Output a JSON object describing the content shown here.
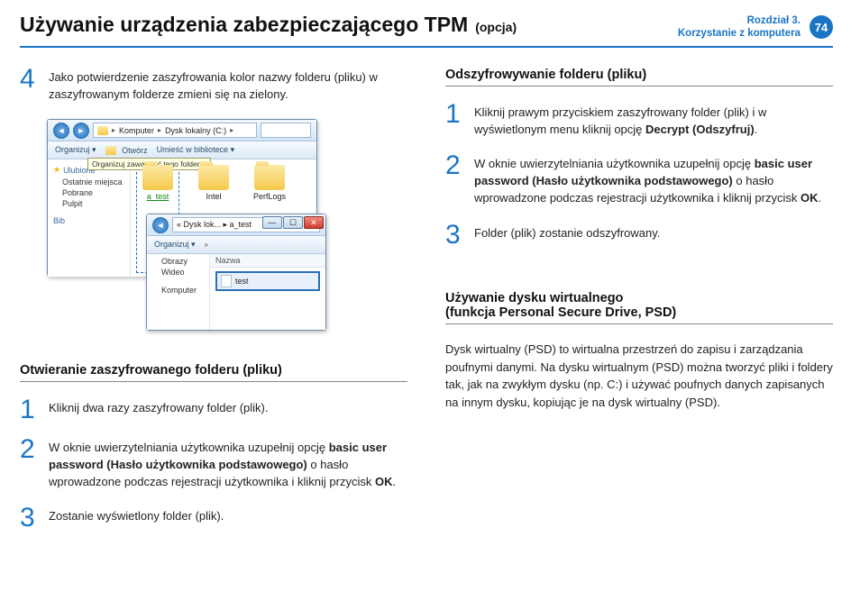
{
  "header": {
    "title": "Używanie urządzenia zabezpieczającego TPM",
    "option": "(opcja)",
    "chapter_line1": "Rozdział 3.",
    "chapter_line2": "Korzystanie z komputera",
    "page_number": "74"
  },
  "left": {
    "step4_num": "4",
    "step4_text": "Jako potwierdzenie zaszyfrowania kolor nazwy folderu (pliku) w zaszyfrowanym folderze zmieni się na zielony.",
    "screenshot": {
      "breadcrumb_parts": [
        "Komputer",
        "Dysk lokalny (C:)"
      ],
      "search_placeholder": "",
      "toolbar": {
        "organize": "Organizuj ▾",
        "open": "Otwórz",
        "library": "Umieść w bibliotece ▾",
        "tooltip": "Organizuj zawartość tego folderu."
      },
      "sidebar": {
        "favorites": "Ulubione",
        "recent": "Ostatnie miejsca",
        "downloads": "Pobrane",
        "desktop": "Pulpit",
        "libs": "Bib"
      },
      "folders": {
        "f1": "a_test",
        "f2": "Intel",
        "f3": "PerfLogs"
      },
      "win2": {
        "path": "« Dysk lok... ▸ a_test",
        "organize": "Organizuj ▾",
        "col_header": "Nazwa",
        "side_images": "Obrazy",
        "side_video": "Wideo",
        "side_computer": "Komputer",
        "file": "test"
      }
    },
    "subhead_open": "Otwieranie zaszyfrowanego folderu (pliku)",
    "open1_num": "1",
    "open1_text": "Kliknij dwa razy zaszyfrowany folder (plik).",
    "open2_num": "2",
    "open2_pre": "W oknie uwierzytelniania użytkownika uzupełnij opcję ",
    "open2_bold": "basic user password (Hasło użytkownika podstawowego)",
    "open2_mid": " o hasło wprowadzone podczas rejestracji użytkownika i kliknij przycisk ",
    "open2_ok": "OK",
    "open2_post": ".",
    "open3_num": "3",
    "open3_text": "Zostanie wyświetlony folder (plik)."
  },
  "right": {
    "subhead_decrypt": "Odszyfrowywanie folderu (pliku)",
    "d1_num": "1",
    "d1_pre": "Kliknij prawym przyciskiem zaszyfrowany folder (plik) i w wyświetlonym menu kliknij opcję ",
    "d1_bold": "Decrypt (Odszyfruj)",
    "d1_post": ".",
    "d2_num": "2",
    "d2_pre": "W oknie uwierzytelniania użytkownika uzupełnij opcję ",
    "d2_bold": "basic user password (Hasło użytkownika podstawowego)",
    "d2_mid": " o hasło wprowadzone podczas rejestracji użytkownika i kliknij przycisk ",
    "d2_ok": "OK",
    "d2_post": ".",
    "d3_num": "3",
    "d3_text": "Folder (plik) zostanie odszyfrowany.",
    "subhead_psd_l1": "Używanie dysku wirtualnego",
    "subhead_psd_l2": "(funkcja Personal Secure Drive, PSD)",
    "psd_para": "Dysk wirtualny (PSD) to wirtualna przestrzeń do zapisu i zarządzania poufnymi danymi. Na dysku wirtualnym (PSD) można tworzyć pliki i foldery tak, jak na zwykłym dysku (np. C:) i używać poufnych danych zapisanych na innym dysku, kopiując je na dysk wirtualny (PSD)."
  }
}
